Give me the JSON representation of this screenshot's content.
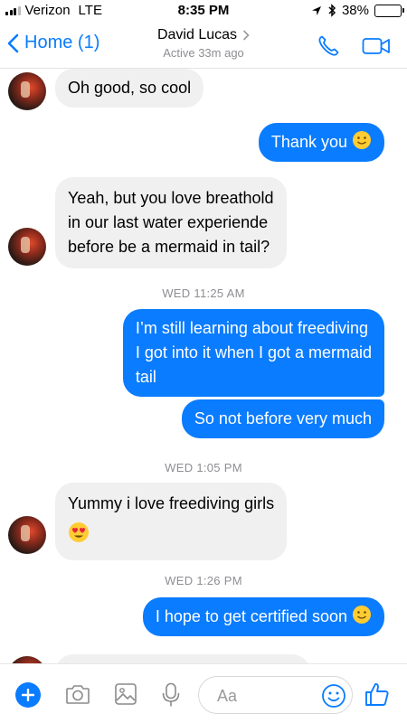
{
  "status_bar": {
    "carrier": "Verizon",
    "network": "LTE",
    "time": "8:35 PM",
    "battery": "38%",
    "battery_level": 0.38
  },
  "nav": {
    "back_label": "Home (1)",
    "contact_name": "David Lucas",
    "contact_status": "Active 33m ago",
    "icons": [
      "chevron-left-icon",
      "chevron-right-icon",
      "phone-icon",
      "video-call-icon"
    ]
  },
  "messages": [
    {
      "side": "in",
      "text": "Oh good, so cool"
    },
    {
      "side": "out",
      "text": "Thank you",
      "emoji": "slightly-smiling-face"
    },
    {
      "side": "in",
      "lines": [
        "Yeah, but you love breathold",
        "in our last water experiende",
        "before be a mermaid in tail?"
      ]
    },
    {
      "side": "time",
      "text": "WED 11:25 AM"
    },
    {
      "side": "out",
      "lines": [
        "I’m still learning about freediving",
        "I got into it when I got a mermaid",
        "tail"
      ]
    },
    {
      "side": "out",
      "text": "So not before very much"
    },
    {
      "side": "time",
      "text": "WED 1:05 PM"
    },
    {
      "side": "in",
      "text": "Yummy  i love freediving girls",
      "emoji": "heart-eyes-face"
    },
    {
      "side": "time",
      "text": "WED 1:26 PM"
    },
    {
      "side": "out",
      "text": "I hope to get certified soon",
      "emoji": "slightly-smiling-face"
    }
  ],
  "composer": {
    "placeholder": "Aa",
    "icons": [
      "plus-icon",
      "camera-icon",
      "image-icon",
      "microphone-icon",
      "emoji-icon",
      "thumbs-up-icon"
    ]
  },
  "colors": {
    "accent": "#0a7cff",
    "incoming_bubble": "#f1f0f0",
    "timestamp": "#8e8e93",
    "battery": "#f5c400"
  }
}
